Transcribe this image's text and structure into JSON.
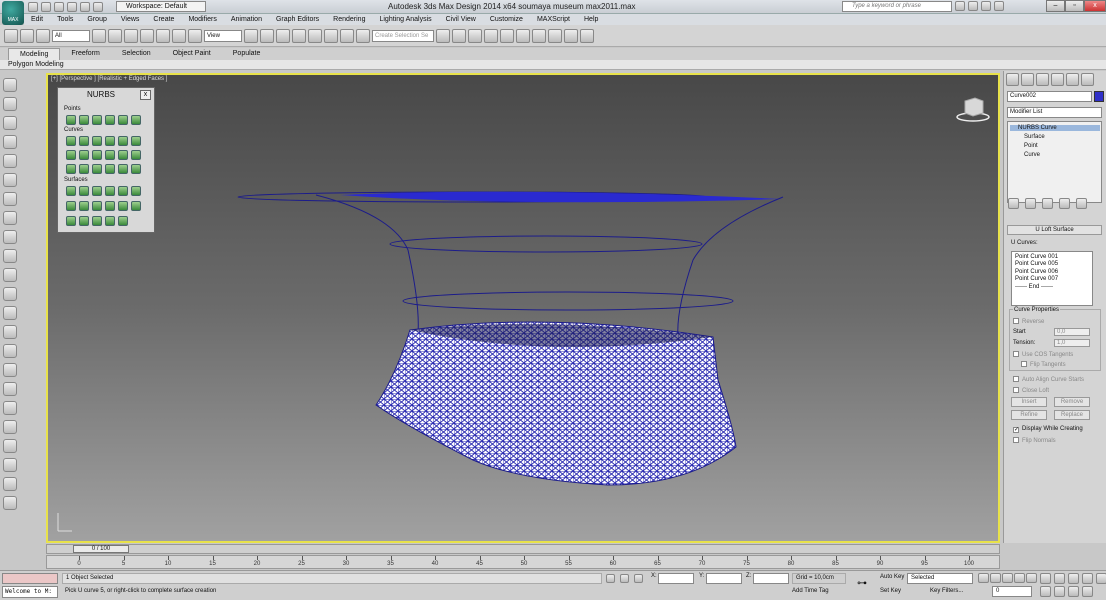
{
  "titlebar": {
    "logo_text": "MAX",
    "workspace": "Workspace: Default",
    "title": "Autodesk 3ds Max Design 2014 x64     soumaya museum max2011.max",
    "search_placeholder": "Type a keyword or phrase"
  },
  "menu": [
    "Edit",
    "Tools",
    "Group",
    "Views",
    "Create",
    "Modifiers",
    "Animation",
    "Graph Editors",
    "Rendering",
    "Lighting Analysis",
    "Civil View",
    "Customize",
    "MAXScript",
    "Help"
  ],
  "toolbar": {
    "filter": "All",
    "coord_system": "View",
    "selection_set_placeholder": "Create Selection Se"
  },
  "ribbon": {
    "tabs": [
      "Modeling",
      "Freeform",
      "Selection",
      "Object Paint",
      "Populate"
    ],
    "active_tab": "Modeling",
    "sub_label": "Polygon Modeling"
  },
  "viewport": {
    "label": "[+] [Perspective ] [Realistic + Edged Faces ]",
    "border_color": "#e8e24a",
    "mesh_color": "#2828b0"
  },
  "nurbs": {
    "title": "NURBS",
    "close": "x",
    "sections": [
      "Points",
      "Curves",
      "Surfaces"
    ]
  },
  "command_panel": {
    "object_name": "Curve002",
    "object_color": "#3030c8",
    "modifier_list": "Modifier List",
    "stack": [
      "NURBS Curve",
      "Surface",
      "Point",
      "Curve"
    ],
    "rollout_title": "U Loft Surface",
    "ucurves_label": "U Curves:",
    "ucurves": [
      "Point Curve 001",
      "Point Curve 005",
      "Point Curve 006",
      "Point Curve 007",
      "------ End ------"
    ],
    "curve_properties_title": "Curve Properties",
    "reverse": "Reverse",
    "start_label": "Start",
    "start_value": "0,0",
    "tension_label": "Tension:",
    "tension_value": "1,0",
    "use_cos": "Use COS Tangents",
    "flip_tangents": "Flip Tangents",
    "auto_align": "Auto Align Curve Starts",
    "close_loft": "Close Loft",
    "insert": "Insert",
    "remove": "Remove",
    "refine": "Refine",
    "replace": "Replace",
    "display_while_creating": "Display While Creating",
    "flip_normals": "Flip Normals"
  },
  "timeline": {
    "thumb": "0 / 100",
    "ticks": [
      0,
      5,
      10,
      15,
      20,
      25,
      30,
      35,
      40,
      45,
      50,
      55,
      60,
      65,
      70,
      75,
      80,
      85,
      90,
      95,
      100
    ]
  },
  "status": {
    "maxscript": "Welcome to M:",
    "selection": "1 Object Selected",
    "prompt": "Pick U curve 5, or right-click to complete surface creation",
    "x_label": "X:",
    "y_label": "Y:",
    "z_label": "Z:",
    "grid": "Grid = 10,0cm",
    "add_time_tag": "Add Time Tag",
    "auto_key": "Auto Key",
    "set_key": "Set Key",
    "selected": "Selected",
    "key_filters": "Key Filters...",
    "frame": "0"
  }
}
